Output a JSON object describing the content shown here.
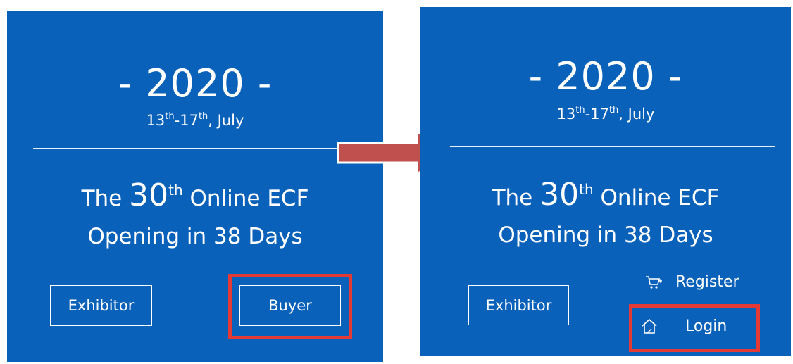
{
  "left_panel": {
    "year": "- 2020 -",
    "dates": {
      "start_day": "13",
      "start_suffix": "th",
      "separator": "-",
      "end_day": "17",
      "end_suffix": "th",
      "month": ", July"
    },
    "headline": {
      "prefix": "The ",
      "number": "30",
      "suffix": "th",
      "rest": " Online ECF"
    },
    "subline": "Opening in 38 Days",
    "exhibitor_label": "Exhibitor",
    "buyer_label": "Buyer"
  },
  "right_panel": {
    "year": "- 2020 -",
    "dates": {
      "start_day": "13",
      "start_suffix": "th",
      "separator": "-",
      "end_day": "17",
      "end_suffix": "th",
      "month": ", July"
    },
    "headline": {
      "prefix": "The ",
      "number": "30",
      "suffix": "th",
      "rest": " Online ECF"
    },
    "subline": "Opening in 38 Days",
    "exhibitor_label": "Exhibitor",
    "register_label": "Register",
    "login_label": "Login",
    "register_icon": "cart-icon",
    "login_icon": "home-icon"
  },
  "colors": {
    "panel_bg": "#0a61b9",
    "highlight": "#e53935",
    "arrow": "#c0504d"
  }
}
